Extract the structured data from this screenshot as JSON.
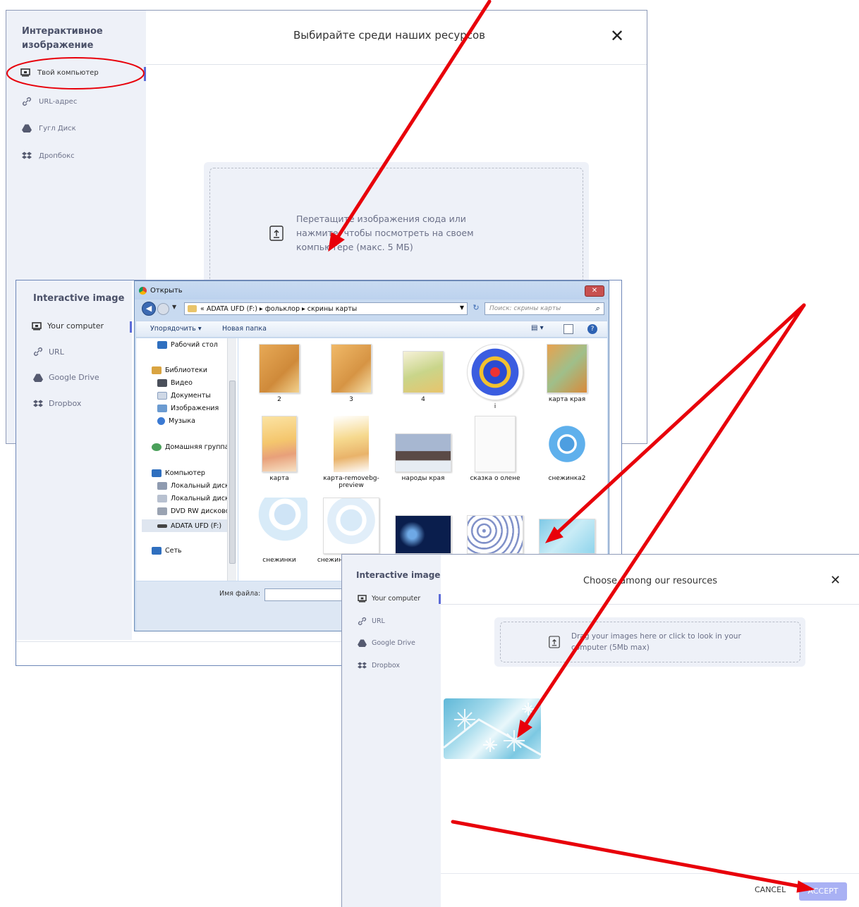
{
  "ru_dialog": {
    "sidebar_title": "Интерактивное изображение",
    "header_title": "Выбирайте среди наших ресурсов",
    "close_icon": "close-icon",
    "items": [
      {
        "label": "Твой компьютер",
        "icon": "monitor-icon"
      },
      {
        "label": "URL-адрес",
        "icon": "link-icon"
      },
      {
        "label": "Гугл Диск",
        "icon": "google-drive-icon"
      },
      {
        "label": "Дропбокс",
        "icon": "dropbox-icon"
      }
    ],
    "dropzone_text": "Перетащите изображения сюда или нажмите, чтобы посмотреть на своем компьютере (макс. 5 МБ)"
  },
  "en_dialog_back": {
    "sidebar_title": "Interactive image",
    "items": [
      {
        "label": "Your computer",
        "icon": "monitor-icon"
      },
      {
        "label": "URL",
        "icon": "link-icon"
      },
      {
        "label": "Google Drive",
        "icon": "google-drive-icon"
      },
      {
        "label": "Dropbox",
        "icon": "dropbox-icon"
      }
    ]
  },
  "file_dialog": {
    "title": "Открыть",
    "breadcrumb": "« ADATA UFD (F:) ▸ фольклор ▸ скрины карты",
    "search_placeholder": "Поиск: скрины карты",
    "toolbar": {
      "organize": "Упорядочить ▾",
      "new_folder": "Новая папка"
    },
    "nav": [
      "Рабочий стол",
      "Библиотеки",
      "Видео",
      "Документы",
      "Изображения",
      "Музыка",
      "Домашняя группа",
      "Компьютер",
      "Локальный диск",
      "Локальный диск",
      "DVD RW дисковод",
      "ADATA UFD (F:)",
      "Сеть"
    ],
    "files": [
      "2",
      "3",
      "4",
      "i",
      "карта края",
      "карта",
      "карта-removebg-preview",
      "народы края",
      "сказка о олене",
      "снежинка2",
      "снежинки",
      "снежинки-removebg",
      "",
      "",
      ""
    ],
    "filename_label": "Имя файла:"
  },
  "en_dialog_front": {
    "sidebar_title": "Interactive image",
    "header_title": "Choose among our resources",
    "items": [
      {
        "label": "Your computer",
        "icon": "monitor-icon"
      },
      {
        "label": "URL",
        "icon": "link-icon"
      },
      {
        "label": "Google Drive",
        "icon": "google-drive-icon"
      },
      {
        "label": "Dropbox",
        "icon": "dropbox-icon"
      }
    ],
    "dropzone_text": "Drag your images here or click to look in your computer (5Mb max)",
    "cancel_label": "CANCEL",
    "accept_label": "ACCEPT"
  },
  "colors": {
    "accent": "#5c6bd8",
    "arrow": "#e8000a",
    "sidebar": "#eef1f8",
    "accept": "#a9b1f4"
  }
}
